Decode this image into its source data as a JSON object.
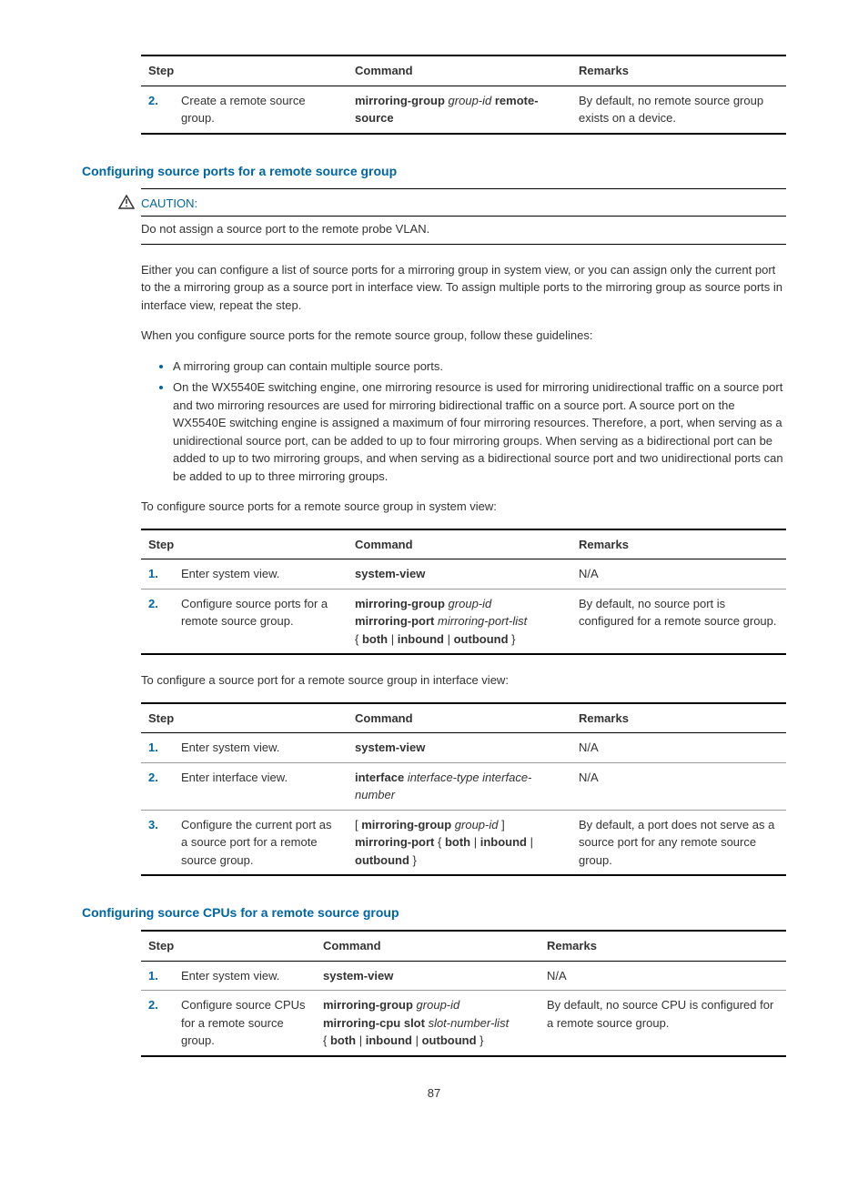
{
  "table1": {
    "headers": {
      "step": "Step",
      "command": "Command",
      "remarks": "Remarks"
    },
    "rows": [
      {
        "num": "2.",
        "step": "Create a remote source group.",
        "cmd_b1": "mirroring-group ",
        "cmd_i1": "group-id ",
        "cmd_b2": "remote-source",
        "remarks": "By default, no remote source group exists on a device."
      }
    ]
  },
  "heading1": "Configuring source ports for a remote source group",
  "caution": {
    "label": "CAUTION:",
    "text": "Do not assign a source port to the remote probe VLAN."
  },
  "para1": "Either you can configure a list of source ports for a mirroring group in system view, or you can assign only the current port to the a mirroring group as a source port in interface view. To assign multiple ports to the mirroring group as source ports in interface view, repeat the step.",
  "para2": "When you configure source ports for the remote source group, follow these guidelines:",
  "bullets": [
    "A mirroring group can contain multiple source ports.",
    "On the WX5540E switching engine, one mirroring resource is used for mirroring unidirectional traffic on a source port and two mirroring resources are used for mirroring bidirectional traffic on a source port. A source port on the WX5540E switching engine is assigned a maximum of four mirroring resources. Therefore, a port, when serving as a unidirectional source port, can be added to up to four mirroring groups. When serving as a bidirectional port can be added to up to two mirroring groups, and when serving as a bidirectional source port and two unidirectional ports can be added to up to three mirroring groups."
  ],
  "para3": "To configure source ports for a remote source group in system view:",
  "table2": {
    "headers": {
      "step": "Step",
      "command": "Command",
      "remarks": "Remarks"
    },
    "rows": [
      {
        "num": "1.",
        "step": "Enter system view.",
        "cmd": "system-view",
        "remarks": "N/A"
      },
      {
        "num": "2.",
        "step": "Configure source ports for a remote source group.",
        "cmd_b1": "mirroring-group ",
        "cmd_i1": "group-id",
        "cmd_b2": "mirroring-port ",
        "cmd_i2": "mirroring-port-list",
        "cmd_line3": "{ both | inbound | outbound }",
        "remarks": "By default, no source port is configured for a remote source group."
      }
    ]
  },
  "para4": "To configure a source port for a remote source group in interface view:",
  "table3": {
    "headers": {
      "step": "Step",
      "command": "Command",
      "remarks": "Remarks"
    },
    "rows": [
      {
        "num": "1.",
        "step": "Enter system view.",
        "cmd": "system-view",
        "remarks": "N/A"
      },
      {
        "num": "2.",
        "step": "Enter interface view.",
        "cmd_b1": "interface ",
        "cmd_i1": "interface-type interface-number",
        "remarks": "N/A"
      },
      {
        "num": "3.",
        "step": "Configure the current port as a source port for a remote source group.",
        "cmd_line1a": "[ ",
        "cmd_line1b": "mirroring-group ",
        "cmd_line1c": "group-id ",
        "cmd_line1d": "]",
        "cmd_b2": "mirroring-port { both | inbound | outbound }",
        "remarks": "By default, a port does not serve as a source port for any remote source group."
      }
    ]
  },
  "heading2": "Configuring source CPUs for a remote source group",
  "table4": {
    "headers": {
      "step": "Step",
      "command": "Command",
      "remarks": "Remarks"
    },
    "rows": [
      {
        "num": "1.",
        "step": "Enter system view.",
        "cmd": "system-view",
        "remarks": "N/A"
      },
      {
        "num": "2.",
        "step": "Configure source CPUs for a remote source group.",
        "cmd_b1": "mirroring-group ",
        "cmd_i1": "group-id",
        "cmd_b2": "mirroring-cpu slot ",
        "cmd_i2": "slot-number-list",
        "cmd_line3": "{ both | inbound | outbound }",
        "remarks": "By default, no source CPU is configured for a remote source group."
      }
    ]
  },
  "pageNum": "87"
}
